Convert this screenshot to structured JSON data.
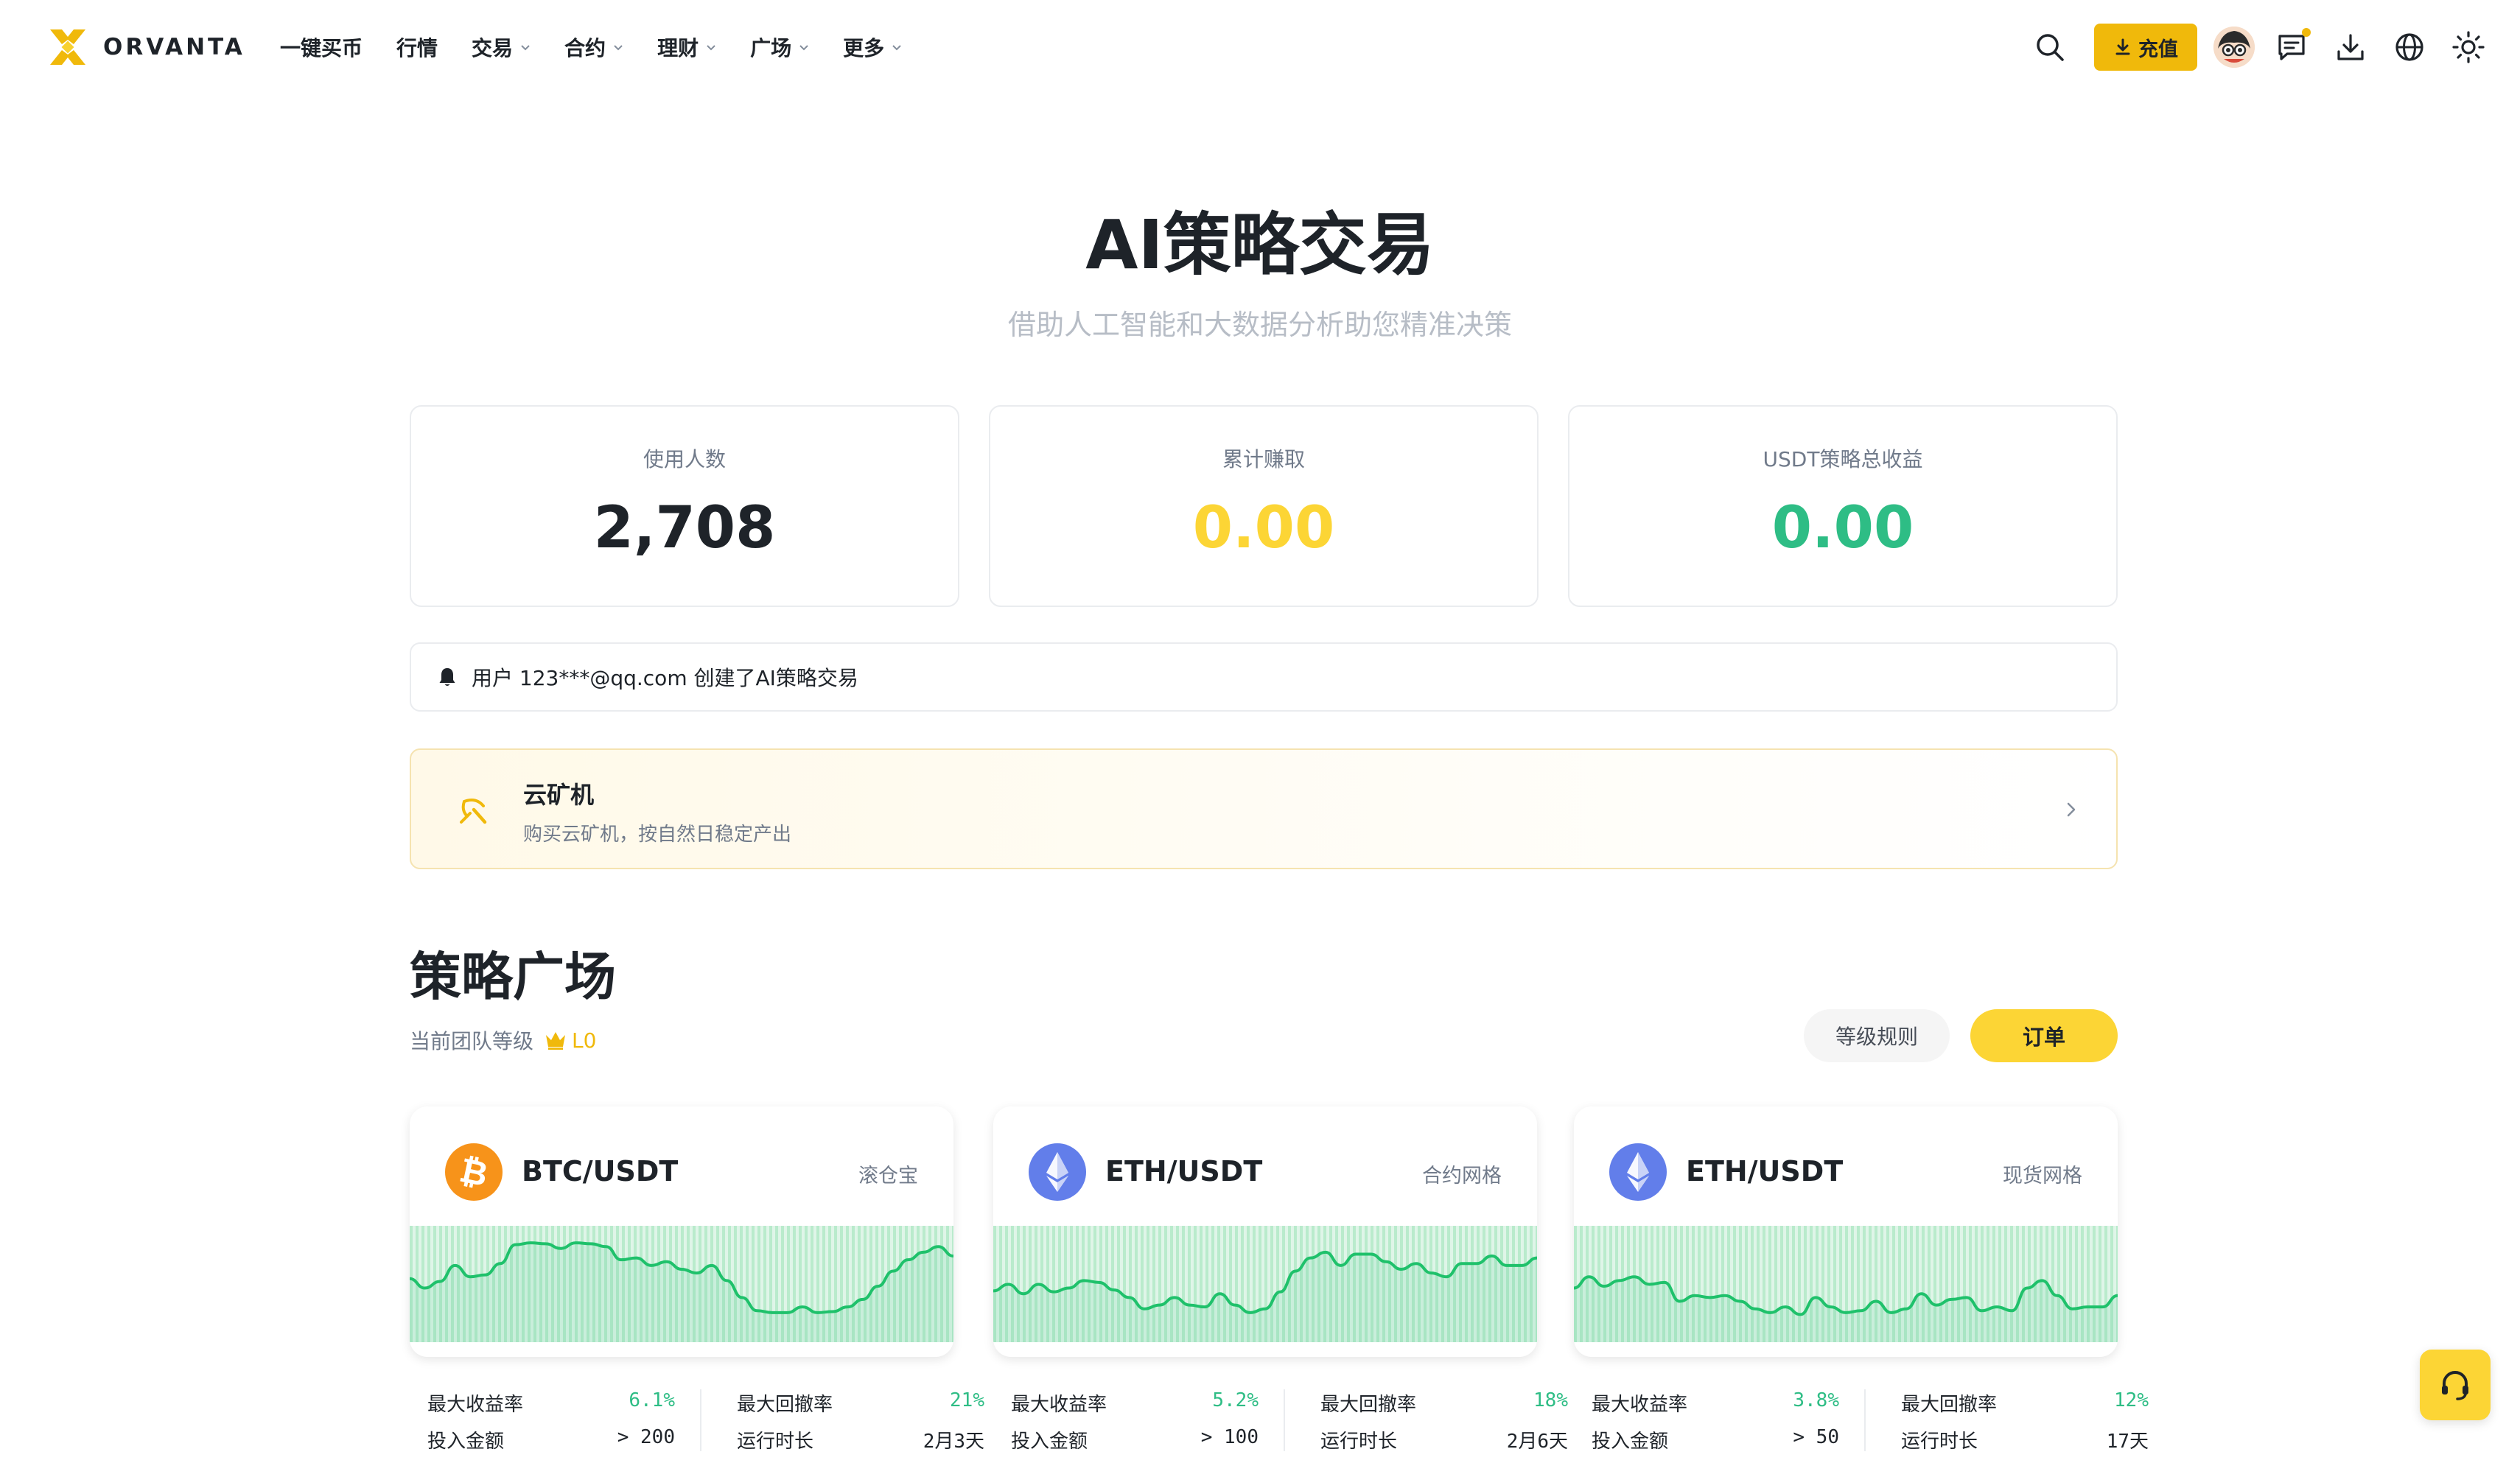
{
  "brand": {
    "name": "ORVANTA",
    "accent": "#f0b90b"
  },
  "nav": {
    "items": [
      {
        "label": "一键买币",
        "has_dropdown": false
      },
      {
        "label": "行情",
        "has_dropdown": false
      },
      {
        "label": "交易",
        "has_dropdown": true
      },
      {
        "label": "合约",
        "has_dropdown": true
      },
      {
        "label": "理财",
        "has_dropdown": true
      },
      {
        "label": "广场",
        "has_dropdown": true
      },
      {
        "label": "更多",
        "has_dropdown": true
      }
    ],
    "deposit_label": "充值",
    "icons": [
      "search-icon",
      "download-arrow-icon",
      "avatar",
      "message-icon",
      "download-icon",
      "globe-icon",
      "sun-icon"
    ]
  },
  "hero": {
    "title": "AI策略交易",
    "subtitle": "借助人工智能和大数据分析助您精准决策"
  },
  "stats": [
    {
      "label": "使用人数",
      "value": "2,708",
      "color": "#1e2329"
    },
    {
      "label": "累计赚取",
      "value": "0.00",
      "color": "#fcd535"
    },
    {
      "label": "USDT策略总收益",
      "value": "0.00",
      "color": "#2ebd85"
    }
  ],
  "notice": {
    "text": "用户 123***@qq.com 创建了AI策略交易",
    "icon": "bell-icon"
  },
  "miner": {
    "title": "云矿机",
    "subtitle": "购买云矿机，按自然日稳定产出",
    "icon": "pickaxe-icon"
  },
  "plaza": {
    "title": "策略广场",
    "team_label": "当前团队等级",
    "team_level": "L0",
    "rules_label": "等级规则",
    "orders_label": "订单"
  },
  "strategies": [
    {
      "pair": "BTC/USDT",
      "kind": "滚仓宝",
      "coin": "bitcoin-icon",
      "coin_color": "#f7931a",
      "metrics": {
        "left": [
          {
            "label": "最大收益率",
            "value": "6.1%",
            "green": true
          },
          {
            "label": "投入金额",
            "value": "> 200",
            "green": false
          }
        ],
        "right": [
          {
            "label": "最大回撤率",
            "value": "21%",
            "green": true
          },
          {
            "label": "运行时长",
            "value": "2月3天",
            "green": false
          }
        ]
      },
      "trend": [
        0.58,
        0.48,
        0.55,
        0.72,
        0.6,
        0.62,
        0.74,
        0.94,
        0.96,
        0.95,
        0.9,
        0.96,
        0.95,
        0.92,
        0.78,
        0.8,
        0.72,
        0.76,
        0.68,
        0.64,
        0.72,
        0.56,
        0.38,
        0.24,
        0.22,
        0.22,
        0.28,
        0.22,
        0.23,
        0.28,
        0.36,
        0.5,
        0.66,
        0.78,
        0.86,
        0.92,
        0.82
      ]
    },
    {
      "pair": "ETH/USDT",
      "kind": "合约网格",
      "coin": "ethereum-icon",
      "coin_color": "#627eea",
      "metrics": {
        "left": [
          {
            "label": "最大收益率",
            "value": "5.2%",
            "green": true
          },
          {
            "label": "投入金额",
            "value": "> 100",
            "green": false
          }
        ],
        "right": [
          {
            "label": "最大回撤率",
            "value": "18%",
            "green": true
          },
          {
            "label": "运行时长",
            "value": "2月6天",
            "green": false
          }
        ]
      },
      "trend": [
        0.45,
        0.52,
        0.42,
        0.52,
        0.44,
        0.48,
        0.56,
        0.54,
        0.46,
        0.38,
        0.26,
        0.3,
        0.38,
        0.3,
        0.28,
        0.42,
        0.3,
        0.22,
        0.26,
        0.44,
        0.66,
        0.8,
        0.86,
        0.72,
        0.84,
        0.84,
        0.76,
        0.68,
        0.74,
        0.64,
        0.6,
        0.74,
        0.74,
        0.82,
        0.72,
        0.72,
        0.8
      ]
    },
    {
      "pair": "ETH/USDT",
      "kind": "现货网格",
      "coin": "ethereum-icon",
      "coin_color": "#627eea",
      "metrics": {
        "left": [
          {
            "label": "最大收益率",
            "value": "3.8%",
            "green": true
          },
          {
            "label": "投入金额",
            "value": "> 50",
            "green": false
          }
        ],
        "right": [
          {
            "label": "最大回撤率",
            "value": "12%",
            "green": true
          },
          {
            "label": "运行时长",
            "value": "17天",
            "green": false
          }
        ]
      },
      "trend": [
        0.48,
        0.6,
        0.5,
        0.56,
        0.6,
        0.52,
        0.54,
        0.34,
        0.4,
        0.38,
        0.4,
        0.34,
        0.26,
        0.22,
        0.28,
        0.2,
        0.38,
        0.28,
        0.22,
        0.24,
        0.34,
        0.22,
        0.26,
        0.42,
        0.3,
        0.36,
        0.38,
        0.24,
        0.28,
        0.24,
        0.48,
        0.56,
        0.4,
        0.26,
        0.28,
        0.28,
        0.4
      ]
    }
  ]
}
